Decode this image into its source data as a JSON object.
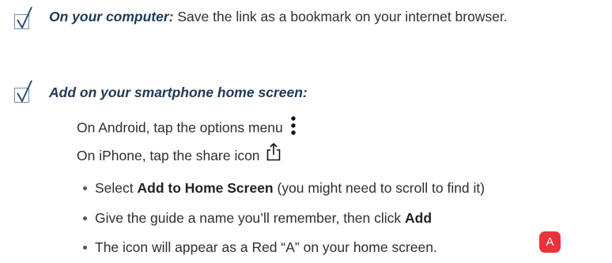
{
  "item1": {
    "lead": "On your computer:",
    "text": " Save the link as a bookmark on your internet browser."
  },
  "item2": {
    "lead": "Add on your smartphone home screen:",
    "android": "On Android, tap the options menu",
    "iphone": "On iPhone, tap the share icon",
    "bullets": [
      {
        "pre": "Select ",
        "bold": "Add to Home Screen",
        "post": " (you might need to scroll to find it)"
      },
      {
        "pre": "Give the guide a name you’ll remember, then click ",
        "bold": "Add",
        "post": ""
      },
      {
        "pre": "The icon will  appear as a Red “A” on your  home screen.",
        "bold": "",
        "post": ""
      }
    ],
    "badge_letter": "A"
  },
  "icons": {
    "checkbox": "checkbox-checked-icon",
    "options_menu": "vertical-dots-icon",
    "share": "share-icon"
  },
  "colors": {
    "badge": "#e8333b",
    "heading": "#1f3a57"
  }
}
